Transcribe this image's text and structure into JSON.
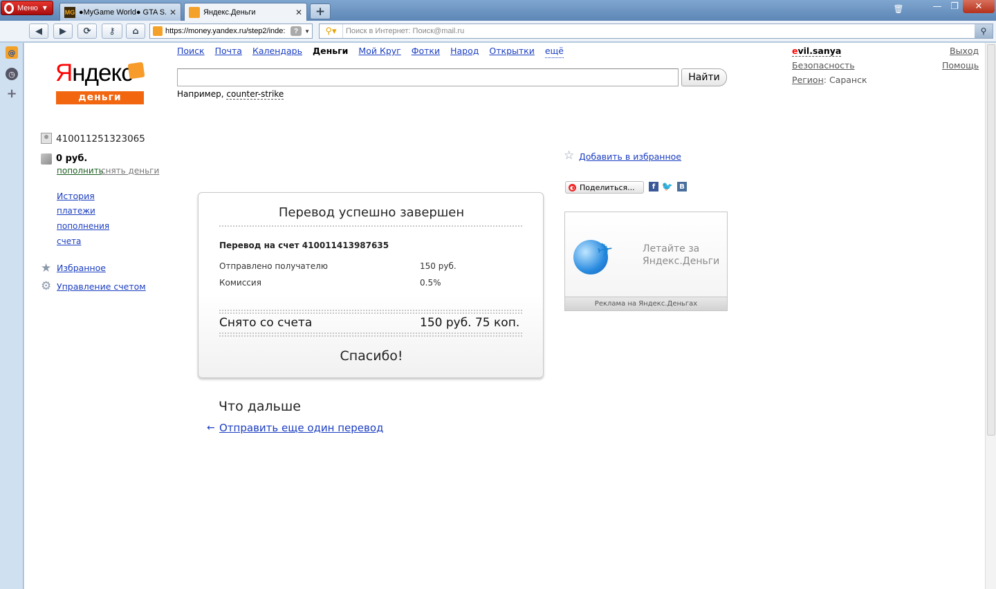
{
  "browser": {
    "menu_label": "Меню",
    "tabs": [
      {
        "favicon": "MG",
        "title": "●MyGame World● GTA S..."
      },
      {
        "title": "Яндекс.Деньги"
      }
    ],
    "newtab_label": "+",
    "url": "https://money.yandex.ru/step2/inde:",
    "search_placeholder": "Поиск в Интернет: Поиск@mail.ru",
    "icons": {
      "back": "arrow-left-icon",
      "forward": "arrow-right-icon",
      "reload": "reload-icon",
      "key": "key-icon",
      "home": "home-icon",
      "trash": "trash-icon"
    }
  },
  "header": {
    "logo_text": "Яндекс",
    "logo_first": "Я",
    "logo_rest": "ндекс",
    "logo_sub": "деньги",
    "services": [
      "Поиск",
      "Почта",
      "Календарь",
      "Деньги",
      "Мой Круг",
      "Фотки",
      "Народ",
      "Открытки"
    ],
    "services_more": "ещё",
    "search_button": "Найти",
    "example_prefix": "Например,",
    "example_query": "counter-strike",
    "user_first": "e",
    "user_rest": "vil.sanya",
    "logout": "Выход",
    "security": "Безопасность",
    "help": "Помощь",
    "region_label": "Регион",
    "region_value": "Саранск"
  },
  "sidebar": {
    "account_number": "410011251323065",
    "balance": "0 руб.",
    "topup": "пополнить",
    "withdraw": "снять деньги",
    "history": "История",
    "payments": "платежи",
    "topups": "пополнения",
    "bills": "счета",
    "favorites": "Избранное",
    "manage": "Управление счетом"
  },
  "receipt": {
    "title": "Перевод успешно завершен",
    "transfer_to": "Перевод на счет 410011413987635",
    "rows": [
      {
        "label": "Отправлено получателю",
        "value": "150 руб."
      },
      {
        "label": "Комиссия",
        "value": "0.5%"
      }
    ],
    "total_label": "Снято со счета",
    "total_value": "150 руб. 75 коп.",
    "thanks": "Спасибо!"
  },
  "next": {
    "title": "Что дальше",
    "again": "Отправить еще один перевод"
  },
  "right": {
    "add_favorite": "Добавить в избранное",
    "share": "Поделиться...",
    "ad_text": "Летайте за Яндекс.Деньги",
    "ad_caption": "Реклама на Яндекс.Деньгах"
  }
}
